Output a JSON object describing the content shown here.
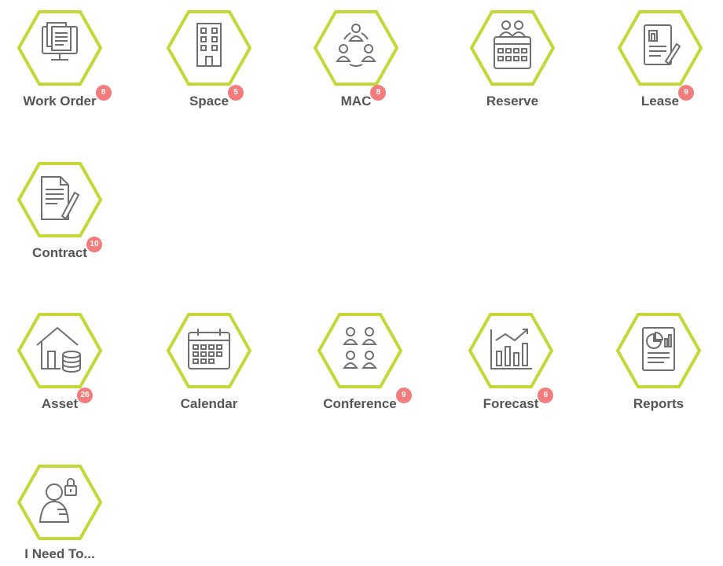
{
  "colors": {
    "hex_border": "#c3d836",
    "icon_stroke": "#6f6f6f",
    "label": "#555555",
    "badge_bg": "#f47c7c"
  },
  "tiles": [
    {
      "label": "Work Order",
      "badge": "8",
      "icon": "monitor-documents-icon"
    },
    {
      "label": "Space",
      "badge": "5",
      "icon": "building-icon"
    },
    {
      "label": "MAC",
      "badge": "8",
      "icon": "people-move-icon"
    },
    {
      "label": "Reserve",
      "badge": "",
      "icon": "reserve-calendar-icon"
    },
    {
      "label": "Lease",
      "badge": "9",
      "icon": "lease-document-icon"
    },
    {
      "label": "Contract",
      "badge": "10",
      "icon": "contract-document-icon"
    },
    {
      "label": "Asset",
      "badge": "26",
      "icon": "house-coins-icon"
    },
    {
      "label": "Calendar",
      "badge": "",
      "icon": "calendar-icon"
    },
    {
      "label": "Conference",
      "badge": "9",
      "icon": "conference-people-icon"
    },
    {
      "label": "Forecast",
      "badge": "6",
      "icon": "forecast-chart-icon"
    },
    {
      "label": "Reports",
      "badge": "",
      "icon": "report-icon"
    },
    {
      "label": "I Need To...",
      "badge": "",
      "icon": "user-lock-icon"
    }
  ]
}
